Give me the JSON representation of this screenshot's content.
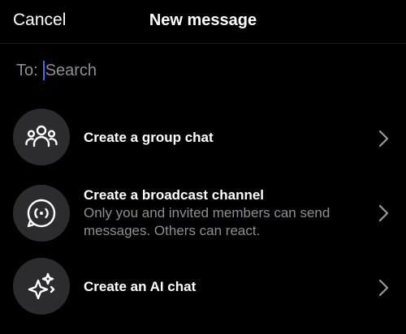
{
  "header": {
    "cancel_label": "Cancel",
    "title": "New message"
  },
  "search": {
    "to_label": "To:",
    "placeholder": "Search"
  },
  "options": [
    {
      "icon": "group-icon",
      "title": "Create a group chat",
      "subtitle": ""
    },
    {
      "icon": "broadcast-icon",
      "title": "Create a broadcast channel",
      "subtitle": "Only you and invited members can send messages. Others can react."
    },
    {
      "icon": "ai-sparkle-icon",
      "title": "Create an AI chat",
      "subtitle": ""
    }
  ],
  "colors": {
    "background": "#000000",
    "text": "#ffffff",
    "secondary_text": "#8e8e93",
    "icon_circle": "#2c2c2e",
    "caret": "#3d6cf5"
  }
}
